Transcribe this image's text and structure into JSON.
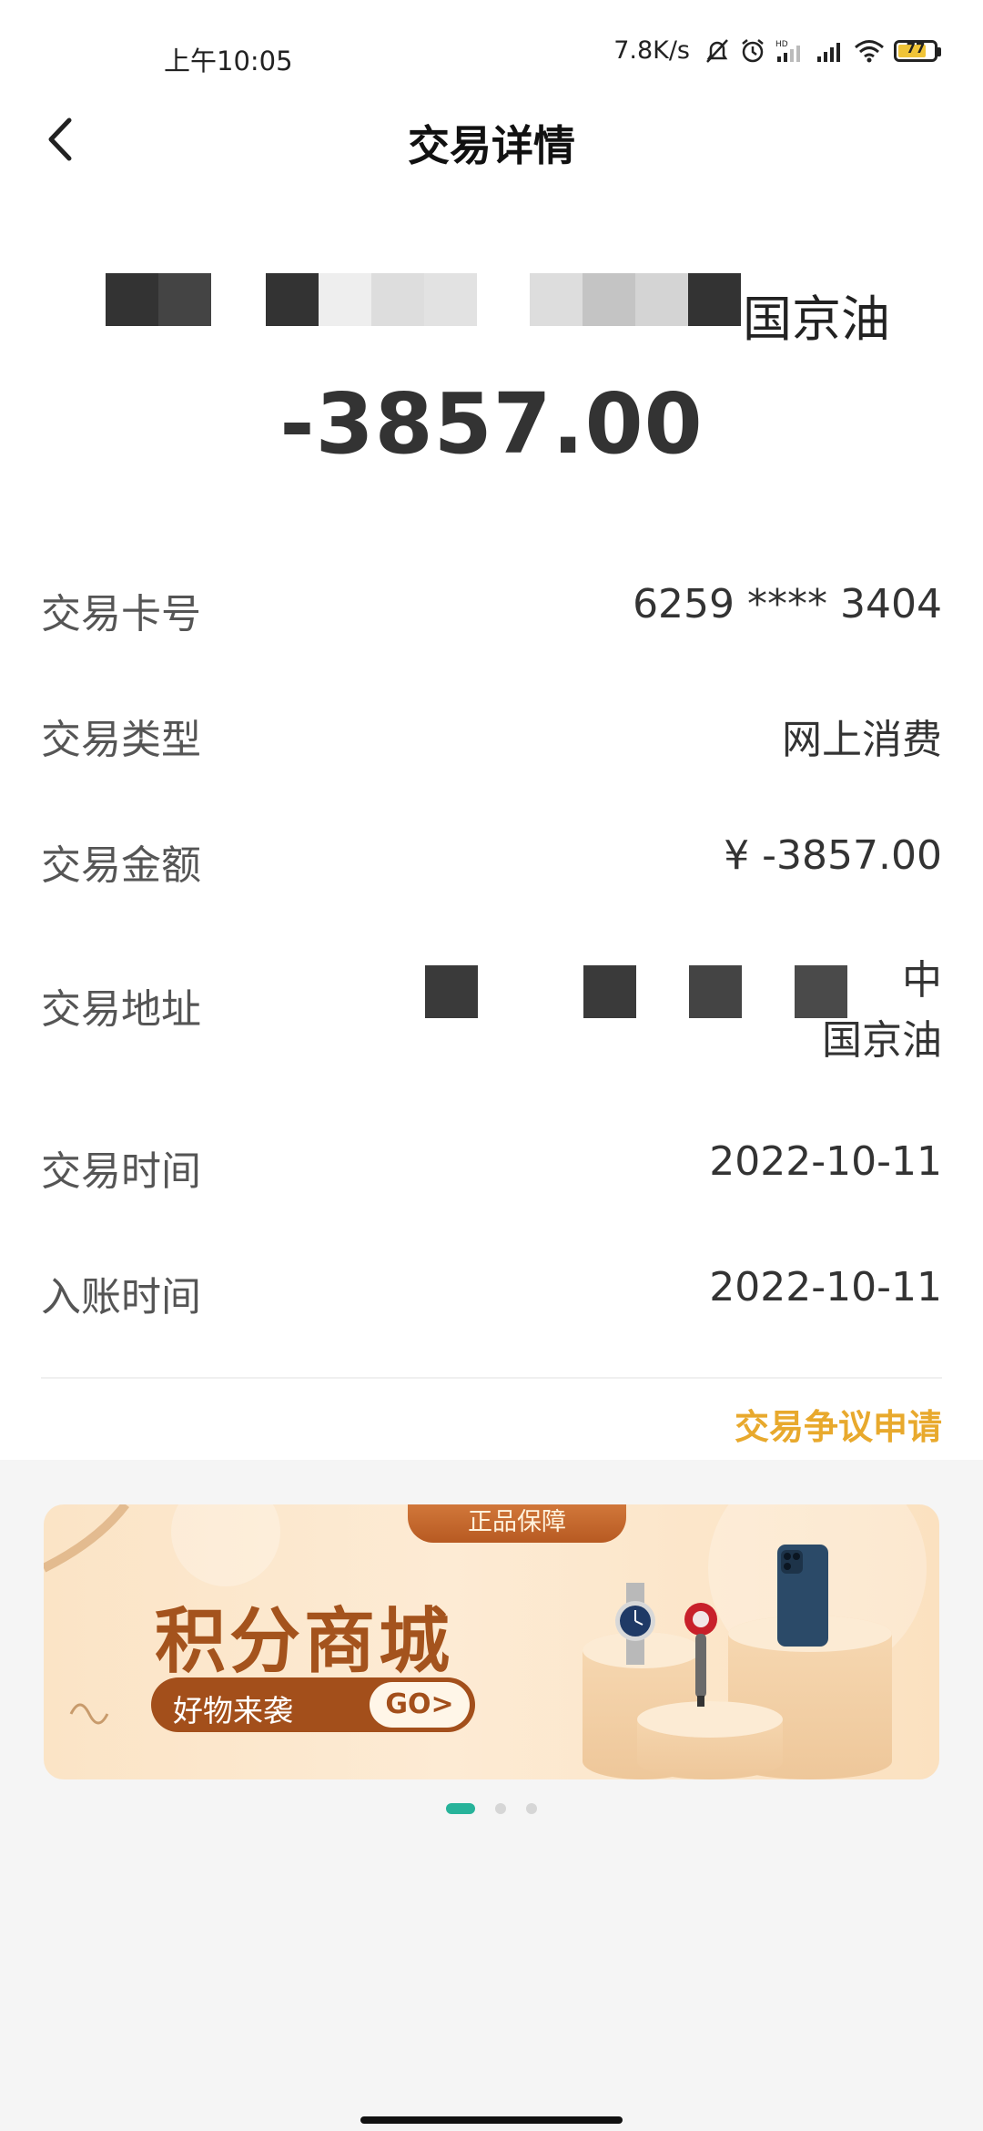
{
  "status_bar": {
    "time": "上午10:05",
    "network_speed": "7.8K/s",
    "battery": "77",
    "icons": [
      "mute-bell-icon",
      "alarm-icon",
      "hd-signal-icon",
      "signal-icon",
      "wifi-icon",
      "battery-icon"
    ]
  },
  "header": {
    "title": "交易详情",
    "back_icon": "chevron-left-icon"
  },
  "merchant": {
    "visible_text": "国京油"
  },
  "amount": "-3857.00",
  "details": [
    {
      "label": "交易卡号",
      "value": "6259 **** 3404"
    },
    {
      "label": "交易类型",
      "value": "网上消费"
    },
    {
      "label": "交易金额",
      "value": "¥ -3857.00"
    },
    {
      "label": "交易地址",
      "value_line1": "中",
      "value_line2": "国京油"
    },
    {
      "label": "交易时间",
      "value": "2022-10-11"
    },
    {
      "label": "入账时间",
      "value": "2022-10-11"
    }
  ],
  "dispute_link": "交易争议申请",
  "banner": {
    "tag": "正品保障",
    "title": "积分商城",
    "subtitle": "好物来袭",
    "go": "GO>",
    "products": [
      "watch-image",
      "hair-dryer-image",
      "phone-image"
    ]
  },
  "carousel": {
    "total": 3,
    "active": 1
  },
  "colors": {
    "accent": "#e8a92d",
    "carousel_active": "#27b39a",
    "banner_brown": "#a4531d"
  }
}
